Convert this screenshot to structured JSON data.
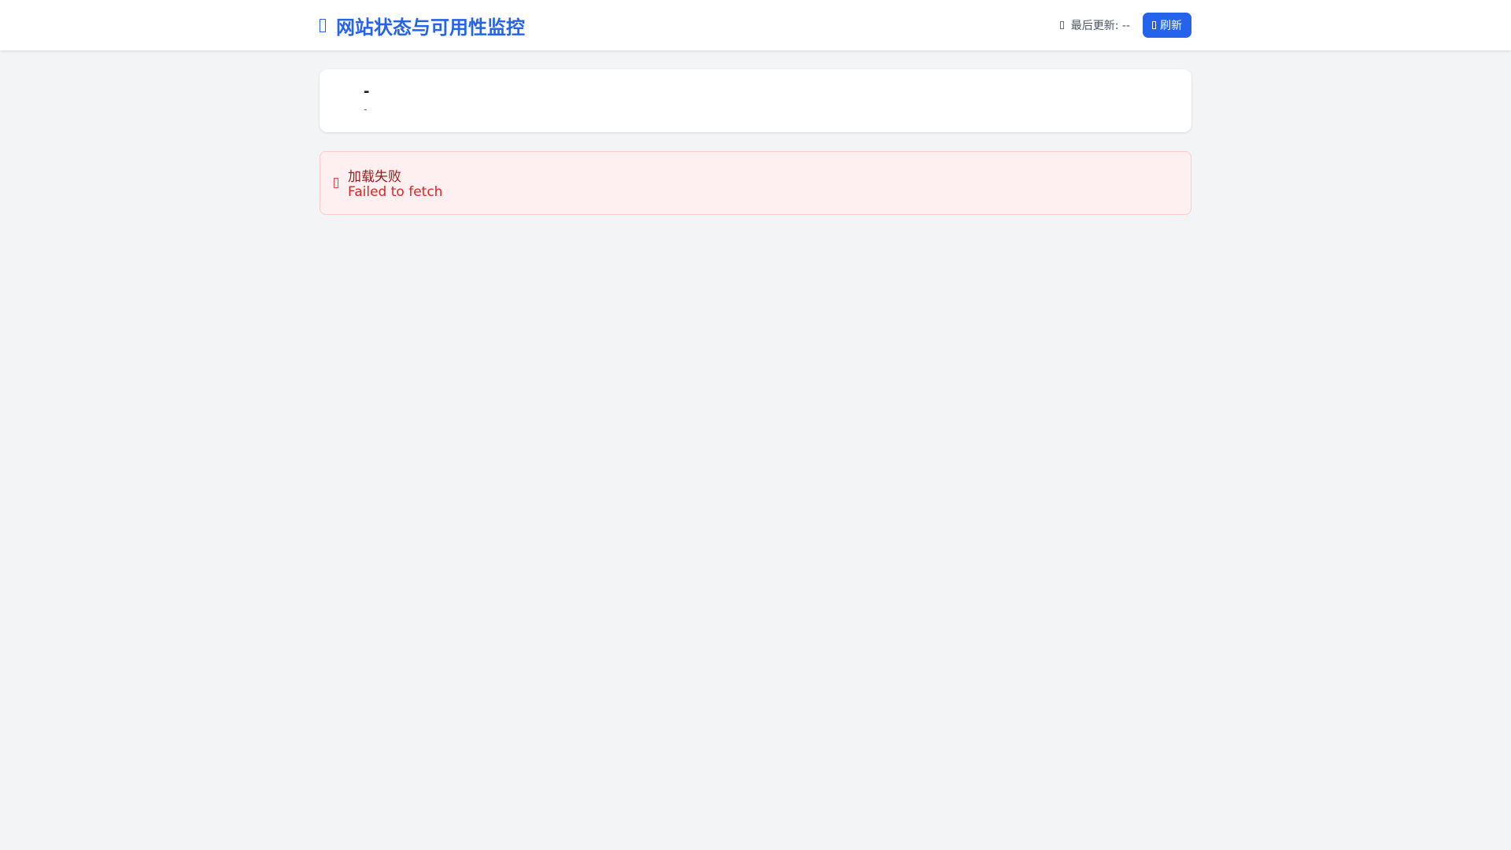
{
  "header": {
    "title": "网站状态与可用性监控",
    "last_updated_label": "最后更新: --",
    "refresh_label": "刷新",
    "accent_color": "#2563eb"
  },
  "site_card": {
    "name": "-",
    "url": "-"
  },
  "error": {
    "title": "加载失败",
    "message": "Failed to fetch"
  }
}
